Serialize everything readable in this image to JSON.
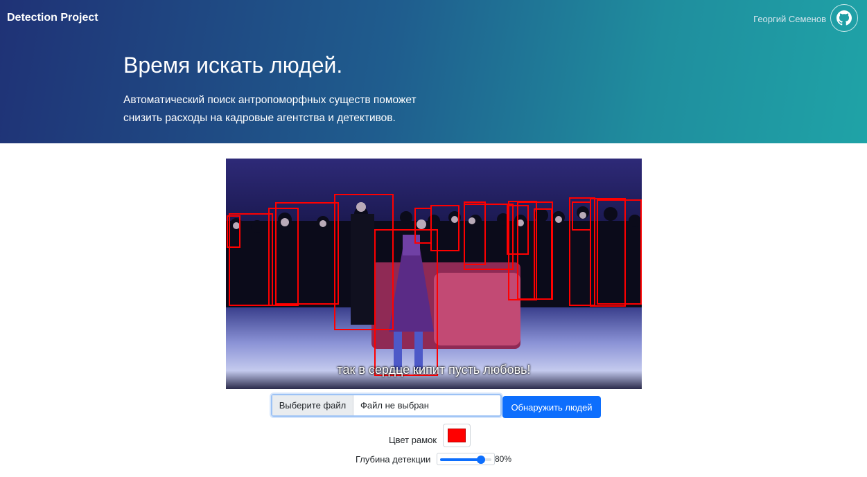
{
  "navbar": {
    "brand": "Detection Project",
    "author": "Георгий Семенов",
    "github_icon": "github-icon"
  },
  "hero": {
    "title": "Время искать людей.",
    "subtitle": "Автоматический поиск антропоморфных существ поможет снизить расходы на кадровые агентства и детективов."
  },
  "preview": {
    "subtitle_text": "так в сердце кипит пусть любовь!",
    "box_color": "#ff0000"
  },
  "controls": {
    "file_button_label": "Выберите файл",
    "file_name": "Файл не выбран",
    "detect_button_label": "Обнаружить людей",
    "color_label": "Цвет рамок",
    "color_value": "#ff0000",
    "depth_label": "Глубина детекции",
    "depth_value": "80%",
    "depth_fraction": 0.8
  }
}
